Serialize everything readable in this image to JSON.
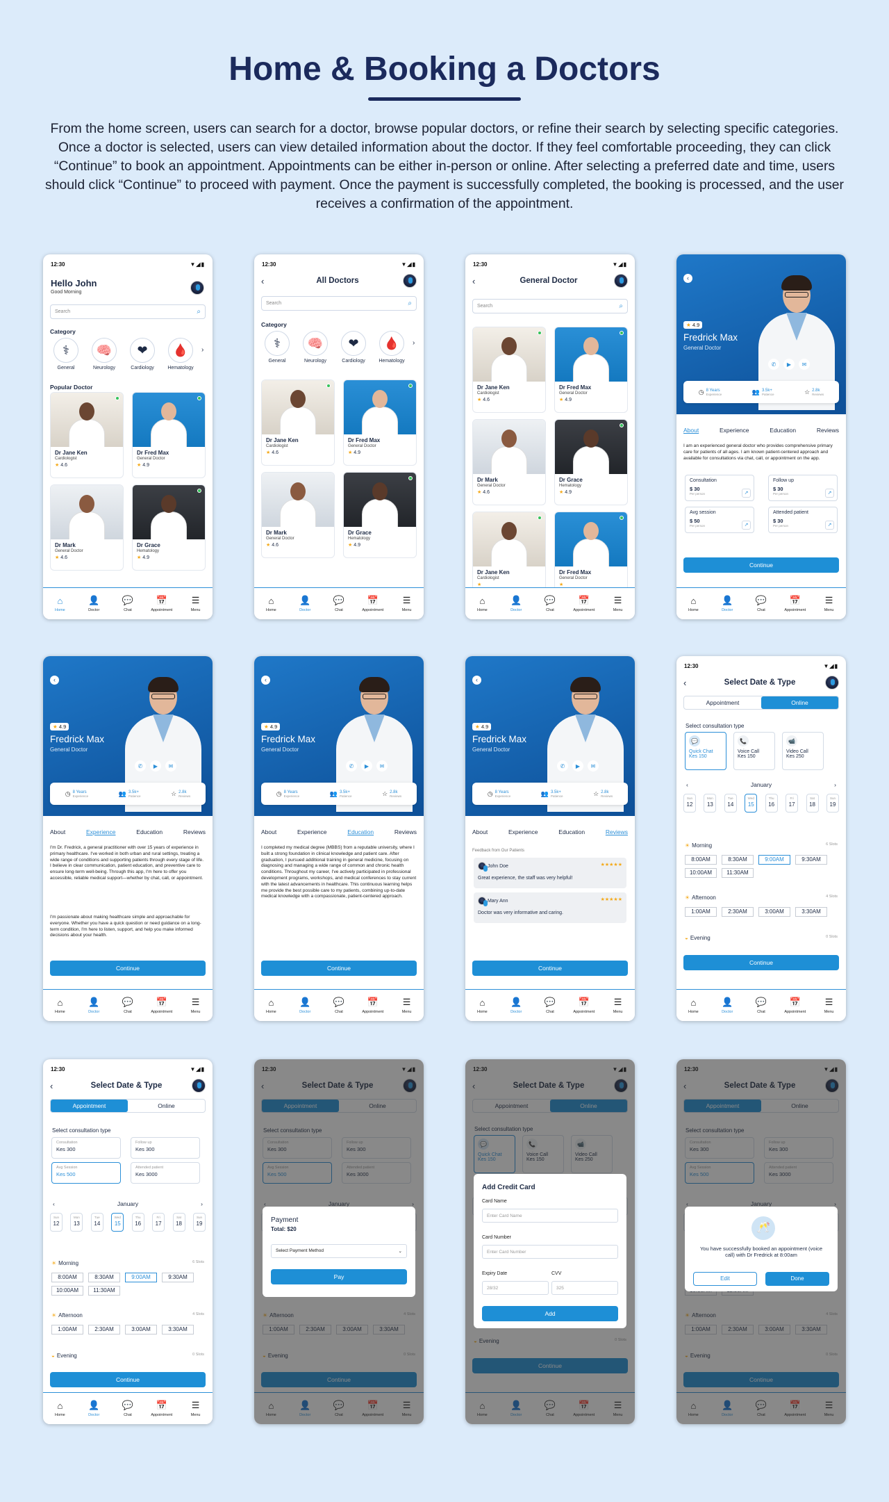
{
  "page": {
    "title": "Home & Booking a Doctors",
    "description": "From the home screen, users can search for a doctor, browse popular doctors, or refine their search by selecting specific categories. Once a doctor is selected, users can view detailed information about the doctor. If they feel comfortable proceeding, they can click “Continue” to book an appointment. Appointments can be either in-person or online. After selecting a preferred date and time, users should click “Continue” to proceed with payment. Once the payment is successfully completed, the booking is processed, and the user receives a confirmation of the appointment."
  },
  "status": {
    "time": "12:30"
  },
  "home": {
    "greeting": "Hello John",
    "subgreeting": "Good Morning",
    "search_placeholder": "Search",
    "category_title": "Category",
    "popular_title": "Popular Doctor"
  },
  "all_doctors": {
    "title": "All Doctors",
    "search_placeholder": "Search",
    "category_title": "Category"
  },
  "general_doctor": {
    "title": "General Doctor",
    "search_placeholder": "Search"
  },
  "categories": [
    {
      "label": "General",
      "icon": "stethoscope-icon",
      "glyph": "⚕"
    },
    {
      "label": "Neurology",
      "icon": "brain-icon",
      "glyph": "🧠"
    },
    {
      "label": "Cardiology",
      "icon": "heart-icon",
      "glyph": "❤"
    },
    {
      "label": "Hematology",
      "icon": "blood-drop-icon",
      "glyph": "🩸"
    }
  ],
  "doctors": [
    {
      "name": "Dr Jane Ken",
      "specialty": "Cardiologist",
      "rating": "4.6",
      "bg": "room",
      "skin": "#6b4632",
      "online": true
    },
    {
      "name": "Dr Fred Max",
      "specialty": "General Doctor",
      "rating": "4.9",
      "bg": "blue",
      "skin": "#e2b79a",
      "online": true
    },
    {
      "name": "Dr Mark",
      "specialty": "General Doctor",
      "rating": "4.6",
      "bg": "office",
      "skin": "#8a5a40",
      "online": false
    },
    {
      "name": "Dr Grace",
      "specialty": "Hematology",
      "rating": "4.9",
      "bg": "dark",
      "skin": "#5a3a2a",
      "online": true
    }
  ],
  "doctor_list_gd": [
    {
      "name": "Dr Jane Ken",
      "specialty": "Cardiologist",
      "rating": "4.6"
    },
    {
      "name": "Dr Fred Max",
      "specialty": "General Doctor",
      "rating": "4.9"
    },
    {
      "name": "Dr Mark",
      "specialty": "General Doctor",
      "rating": "4.6"
    },
    {
      "name": "Dr Grace",
      "specialty": "Hematology",
      "rating": "4.9"
    },
    {
      "name": "Dr Jane Ken",
      "specialty": "Cardiologist",
      "rating": ""
    },
    {
      "name": "Dr Fred Max",
      "specialty": "General Doctor",
      "rating": ""
    }
  ],
  "profile": {
    "rating": "4.9",
    "name": "Fredrick Max",
    "specialty": "General Doctor",
    "stats": [
      {
        "value": "8 Years",
        "label": "Experience",
        "icon": "clock-icon",
        "glyph": "◷"
      },
      {
        "value": "3.5k+",
        "label": "Patience",
        "icon": "patients-icon",
        "glyph": "👥"
      },
      {
        "value": "2.8k",
        "label": "Reviews",
        "icon": "star-icon",
        "glyph": "☆"
      }
    ],
    "tabs": [
      "About",
      "Experience",
      "Education",
      "Reviews"
    ],
    "about": "I am an experienced general doctor who provides comprehensive primary care for patients of all ages. I am known patient-centered approach and available for consultations via chat, call, or appointment on the app.",
    "prices": [
      {
        "label": "Consultation",
        "value": "$ 30",
        "unit": "Per person"
      },
      {
        "label": "Follow up",
        "value": "$ 30",
        "unit": "Per person"
      },
      {
        "label": "Avg session",
        "value": "$ 50",
        "unit": "Per person"
      },
      {
        "label": "Attended patient",
        "value": "$ 30",
        "unit": "Per person"
      }
    ],
    "experience_p1": "I'm Dr. Fredrick, a general practitioner with over 15 years of experience in primary healthcare. I've worked in both urban and rural settings, treating a wide range of conditions and supporting patients through every stage of life. I believe in clear communication, patient education, and preventive care to ensure long-term well-being. Through this app, I'm here to offer you accessible, reliable medical support—whether by chat, call, or appointment.",
    "experience_p2": "I'm passionate about making healthcare simple and approachable for everyone. Whether you have a quick question or need guidance on a long-term condition, I'm here to listen, support, and help you make informed decisions about your health.",
    "education": "I completed my medical degree (MBBS) from a reputable university, where I built a strong foundation in clinical knowledge and patient care. After graduation, I pursued additional training in general medicine, focusing on diagnosing and managing a wide range of common and chronic health conditions. Throughout my career, I've actively participated in professional development programs, workshops, and medical conferences to stay current with the latest advancements in healthcare. This continuous learning helps me provide the best possible care to my patients, combining up-to-date medical knowledge with a compassionate, patient-centered approach.",
    "reviews_title": "Feedback from Our Patients",
    "reviews": [
      {
        "name": "John Doe",
        "text": "Great experience, the staff was very helpful!",
        "stars": "★★★★★"
      },
      {
        "name": "Mary Ann",
        "text": "Doctor was very informative and caring.",
        "stars": "★★★★★"
      }
    ],
    "continue": "Continue"
  },
  "booking": {
    "title": "Select Date & Type",
    "appointment": "Appointment",
    "online": "Online",
    "select_type": "Select consultation type",
    "online_types": [
      {
        "label": "Quick Chat",
        "price": "Kes 150",
        "icon": "chat-icon",
        "glyph": "💬"
      },
      {
        "label": "Voice Call",
        "price": "Kes 150",
        "icon": "phone-icon",
        "glyph": "📞"
      },
      {
        "label": "Video Call",
        "price": "Kes 250",
        "icon": "video-icon",
        "glyph": "📹"
      }
    ],
    "inperson_types": [
      {
        "label": "Consultation",
        "price": "Kes 300"
      },
      {
        "label": "Follow up",
        "price": "Kes 300"
      },
      {
        "label": "Avg Session",
        "price": "Kes 500"
      },
      {
        "label": "Attended patient",
        "price": "Kes 3000"
      }
    ],
    "month": "January",
    "days": [
      {
        "d": "Sun",
        "n": "12"
      },
      {
        "d": "Mon",
        "n": "13"
      },
      {
        "d": "Tue",
        "n": "14"
      },
      {
        "d": "Wed",
        "n": "15"
      },
      {
        "d": "Thu",
        "n": "16"
      },
      {
        "d": "Fri",
        "n": "17"
      },
      {
        "d": "Sat",
        "n": "18"
      },
      {
        "d": "Sun",
        "n": "19"
      }
    ],
    "morning": "Morning",
    "morning_count": "6 Slots",
    "morning_slots": [
      "8:00AM",
      "8:30AM",
      "9:00AM",
      "9:30AM",
      "10:00AM",
      "11:30AM"
    ],
    "afternoon": "Afternoon",
    "afternoon_count": "4 Slots",
    "afternoon_slots": [
      "1:00AM",
      "2:30AM",
      "3:00AM",
      "3:30AM"
    ],
    "evening": "Evening",
    "evening_count": "0 Slots",
    "continue": "Continue"
  },
  "payment": {
    "title": "Payment",
    "total": "Total: $20",
    "method": "Select Payment Method",
    "pay": "Pay"
  },
  "card": {
    "title": "Add Credit Card",
    "name_label": "Card Name",
    "name_ph": "Enter Card Name",
    "number_label": "Card Number",
    "number_ph": "Enter Card Number",
    "expiry_label": "Expiry Date",
    "expiry_ph": "28/32",
    "cvv_label": "CVV",
    "cvv_ph": "325",
    "add": "Add"
  },
  "success": {
    "message": "You have successfully booked an appointment (voice call) with Dr Fredrick at 8:00am",
    "edit": "Edit",
    "done": "Done"
  },
  "nav": [
    {
      "label": "Home",
      "icon": "home-icon",
      "glyph": "⌂"
    },
    {
      "label": "Doctor",
      "icon": "doctor-icon",
      "glyph": "👤"
    },
    {
      "label": "Chat",
      "icon": "chat-icon",
      "glyph": "💬"
    },
    {
      "label": "Appointment",
      "icon": "calendar-icon",
      "glyph": "📅"
    },
    {
      "label": "Menu",
      "icon": "menu-icon",
      "glyph": "☰"
    }
  ],
  "colors": {
    "accent": "#1e8fd6",
    "title": "#1b2a5c",
    "background": "#dcebfa"
  }
}
